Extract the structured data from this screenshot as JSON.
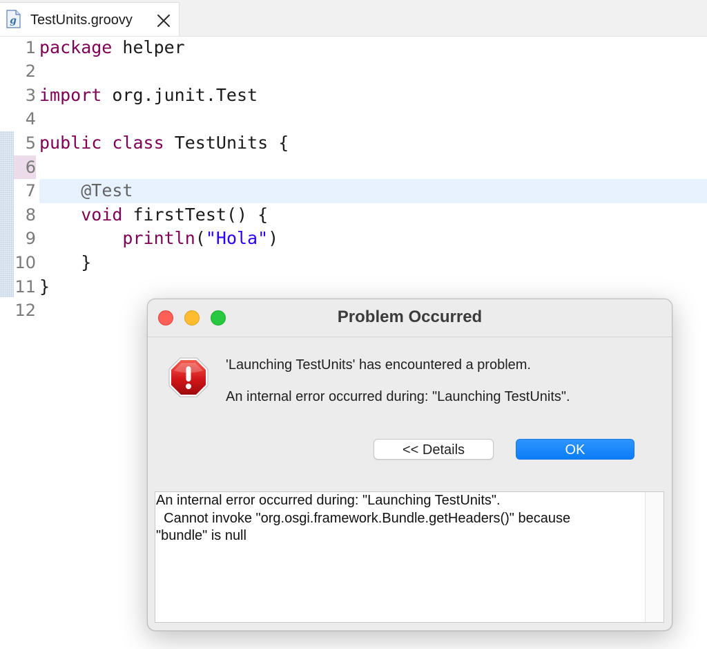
{
  "editor": {
    "tab": {
      "title": "TestUnits.groovy",
      "icon": "groovy-file-icon",
      "close_icon": "close-icon"
    },
    "lines": [
      {
        "num": "1",
        "segments": [
          {
            "t": "package",
            "c": "kw"
          },
          {
            "t": " helper",
            "c": ""
          }
        ]
      },
      {
        "num": "2",
        "segments": []
      },
      {
        "num": "3",
        "segments": [
          {
            "t": "import",
            "c": "kw"
          },
          {
            "t": " org.junit.Test",
            "c": ""
          }
        ]
      },
      {
        "num": "4",
        "segments": []
      },
      {
        "num": "5",
        "segments": [
          {
            "t": "public",
            "c": "kw"
          },
          {
            "t": " ",
            "c": ""
          },
          {
            "t": "class",
            "c": "kw"
          },
          {
            "t": " TestUnits {",
            "c": ""
          }
        ]
      },
      {
        "num": "6",
        "segments": [],
        "marked": true
      },
      {
        "num": "7",
        "segments": [
          {
            "t": "    ",
            "c": ""
          },
          {
            "t": "@Test",
            "c": "ann"
          }
        ],
        "current": true
      },
      {
        "num": "8",
        "segments": [
          {
            "t": "    ",
            "c": ""
          },
          {
            "t": "void",
            "c": "kw"
          },
          {
            "t": " firstTest() {",
            "c": ""
          }
        ]
      },
      {
        "num": "9",
        "segments": [
          {
            "t": "        ",
            "c": ""
          },
          {
            "t": "println",
            "c": "fn"
          },
          {
            "t": "(",
            "c": ""
          },
          {
            "t": "\"Hola\"",
            "c": "str"
          },
          {
            "t": ")",
            "c": ""
          }
        ]
      },
      {
        "num": "10",
        "segments": [
          {
            "t": "    }",
            "c": ""
          }
        ]
      },
      {
        "num": "11",
        "segments": [
          {
            "t": "}",
            "c": ""
          }
        ]
      },
      {
        "num": "12",
        "segments": []
      }
    ]
  },
  "dialog": {
    "title": "Problem Occurred",
    "icon": "error-stop-icon",
    "message_primary": "'Launching TestUnits' has encountered a problem.",
    "message_secondary": "An internal error occurred during: \"Launching TestUnits\".",
    "details_button": "<< Details",
    "ok_button": "OK",
    "details_text": "An internal error occurred during: \"Launching TestUnits\".\n  Cannot invoke \"org.osgi.framework.Bundle.getHeaders()\" because\n\"bundle\" is null"
  },
  "colors": {
    "keyword": "#7f0055",
    "annotation": "#646464",
    "string": "#2a00ff",
    "ok_button": "#0a7df7",
    "current_line": "#e8f2fe"
  }
}
